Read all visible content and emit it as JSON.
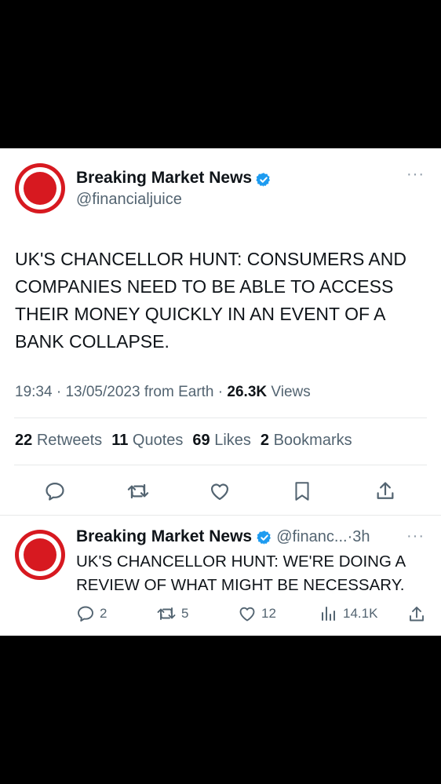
{
  "tweet": {
    "display_name": "Breaking Market News",
    "handle": "@financialjuice",
    "body": "UK'S CHANCELLOR HUNT: CONSUMERS AND COMPANIES NEED TO BE ABLE TO ACCESS THEIR MONEY QUICKLY IN AN EVENT OF A BANK COLLAPSE.",
    "time": "19:34",
    "date": "13/05/2023",
    "source": "from Earth",
    "views_count": "26.3K",
    "views_label": "Views",
    "retweets_count": "22",
    "retweets_label": "Retweets",
    "quotes_count": "11",
    "quotes_label": "Quotes",
    "likes_count": "69",
    "likes_label": "Likes",
    "bookmarks_count": "2",
    "bookmarks_label": "Bookmarks"
  },
  "reply": {
    "display_name": "Breaking Market News",
    "handle": "@financ...",
    "age": "3h",
    "body": "UK'S CHANCELLOR HUNT: WE'RE DOING A REVIEW OF WHAT MIGHT BE NECESSARY.",
    "replies": "2",
    "retweets": "5",
    "likes": "12",
    "views": "14.1K"
  },
  "colors": {
    "accent": "#1d9bf0",
    "brand_red": "#d71920",
    "muted": "#536471"
  }
}
